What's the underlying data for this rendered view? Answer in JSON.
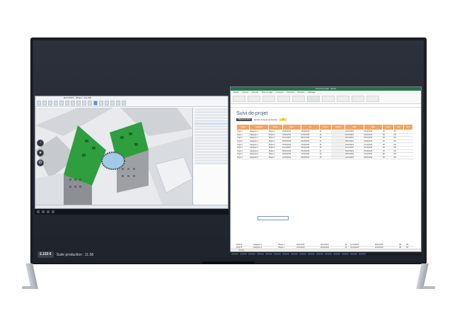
{
  "overlay": {
    "badge": "2.153 €",
    "text": "Suite production : 11.58"
  },
  "cad": {
    "title": "Revit 2019 - [Projet - Vue 3D]",
    "icons": [
      "orbit-icon",
      "zoom-icon"
    ]
  },
  "excel": {
    "title": "Suivi de projet - Excel",
    "tabs": [
      "Fichier",
      "Accueil",
      "Insertion",
      "Mise en page",
      "Formules",
      "Données",
      "Révision",
      "Affichage"
    ],
    "heading": "Suivi de projet",
    "filter_button": "Tableau de bord",
    "filter_text": "Nombre de lignes de données",
    "count": "14",
    "sheet_tab": "Feuil1"
  },
  "table": {
    "headers": [
      "Projet",
      "Catégorie",
      "Phase",
      "Début",
      "Fin",
      "Durée",
      "Réalisé",
      "Date",
      "Date",
      "Statut",
      "Suivi",
      "Note"
    ],
    "rows": [
      [
        "Projet 1",
        "Catégorie 1",
        "Phase 1",
        "01/10/2019",
        "15/10/2019",
        "14",
        "",
        "01/10/2019",
        "15/10/2019",
        "OK",
        "OK",
        ""
      ],
      [
        "Projet 1",
        "Catégorie 1",
        "Phase 2",
        "16/10/2019",
        "01/11/2019",
        "16",
        "",
        "16/10/2019",
        "01/11/2019",
        "OK",
        "OK",
        ""
      ],
      [
        "Projet 1",
        "Catégorie 1",
        "Phase 3",
        "02/11/2019",
        "20/11/2019",
        "18",
        "",
        "02/11/2019",
        "20/11/2019",
        "OK",
        "OK",
        ""
      ],
      [
        "Projet 2",
        "Catégorie 1",
        "Phase 1",
        "05/10/2019",
        "22/10/2019",
        "17",
        "",
        "05/10/2019",
        "22/10/2019",
        "OK",
        "OK",
        ""
      ],
      [
        "Projet 2",
        "Catégorie 1",
        "Phase 2",
        "23/10/2019",
        "10/11/2019",
        "18",
        "",
        "23/10/2019",
        "10/11/2019",
        "OK",
        "OK",
        ""
      ],
      [
        "Projet 2",
        "Catégorie 1",
        "Phase 3",
        "11/11/2019",
        "30/11/2019",
        "19",
        "",
        "11/11/2019",
        "30/11/2019",
        "OK",
        "OK",
        ""
      ],
      [
        "Projet 3",
        "Catégorie 2",
        "Phase 1",
        "08/10/2019",
        "25/10/2019",
        "17",
        "",
        "08/10/2019",
        "25/10/2019",
        "OK",
        "OK",
        ""
      ],
      [
        "Projet 3",
        "Catégorie 2",
        "Phase 2",
        "26/10/2019",
        "14/11/2019",
        "19",
        "",
        "26/10/2019",
        "14/11/2019",
        "OK",
        "OK",
        ""
      ],
      [
        "Projet 4",
        "Catégorie 2",
        "Phase 1",
        "10/10/2019",
        "28/10/2019",
        "18",
        "",
        "10/10/2019",
        "28/10/2019",
        "OK",
        "OK",
        ""
      ]
    ],
    "rows2": [
      [
        "Projet 5",
        "Catégorie 3",
        "Phase 1",
        "12/11/2019",
        "30/11/2019",
        "18",
        "",
        "12/11/2019",
        "30/11/2019",
        "OK",
        "OK",
        ""
      ],
      [
        "Projet 5",
        "Catégorie 3",
        "Phase 2",
        "01/12/2019",
        "20/12/2019",
        "19",
        "",
        "01/12/2019",
        "20/12/2019",
        "OK",
        "OK",
        ""
      ]
    ]
  },
  "colors": {
    "header": "#f4a460",
    "excel_green": "#217346",
    "building": "#2e9e3e"
  }
}
